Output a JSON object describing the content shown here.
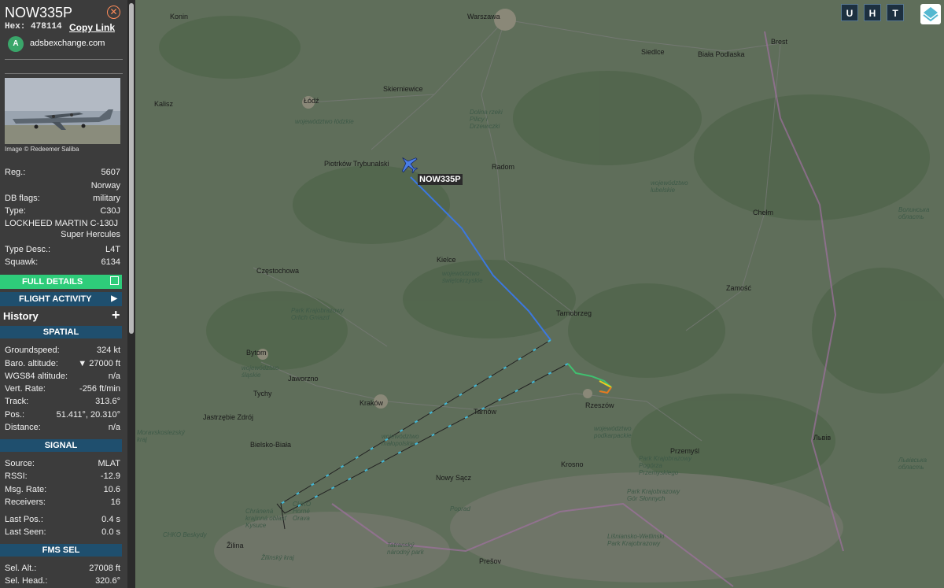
{
  "aircraft": {
    "callsign": "NOW335P",
    "hex_label": "Hex:",
    "hex": "478114",
    "copy_link": "Copy Link",
    "source_site": "adsbexchange.com",
    "photo_credit": "Image © Redeemer Saliba"
  },
  "details": {
    "reg_label": "Reg.:",
    "reg": "5607",
    "country": "Norway",
    "dbflags_label": "DB flags:",
    "dbflags": "military",
    "type_label": "Type:",
    "type": "C30J",
    "type_full_1": "LOCKHEED MARTIN C-130J",
    "type_full_2": "Super Hercules",
    "typedesc_label": "Type Desc.:",
    "typedesc": "L4T",
    "squawk_label": "Squawk:",
    "squawk": "6134"
  },
  "buttons": {
    "full_details": "FULL DETAILS",
    "flight_activity": "FLIGHT ACTIVITY",
    "history": "History"
  },
  "spatial": {
    "title": "SPATIAL",
    "rows": [
      {
        "label": "Groundspeed:",
        "value": "324 kt"
      },
      {
        "label": "Baro. altitude:",
        "value": "▼ 27000 ft"
      },
      {
        "label": "WGS84 altitude:",
        "value": "n/a"
      },
      {
        "label": "Vert. Rate:",
        "value": "-256 ft/min"
      },
      {
        "label": "Track:",
        "value": "313.6°"
      },
      {
        "label": "Pos.:",
        "value": "51.411°, 20.310°"
      },
      {
        "label": "Distance:",
        "value": "n/a"
      }
    ]
  },
  "signal": {
    "title": "SIGNAL",
    "rows": [
      {
        "label": "Source:",
        "value": "MLAT"
      },
      {
        "label": "RSSI:",
        "value": "-12.9"
      },
      {
        "label": "Msg. Rate:",
        "value": "10.6"
      },
      {
        "label": "Receivers:",
        "value": "16"
      },
      {
        "label": "Last Pos.:",
        "value": "0.4 s"
      },
      {
        "label": "Last Seen:",
        "value": "0.0 s"
      }
    ]
  },
  "fms": {
    "title": "FMS SEL",
    "rows": [
      {
        "label": "Sel. Alt.:",
        "value": "27008 ft"
      },
      {
        "label": "Sel. Head.:",
        "value": "320.6°"
      }
    ]
  },
  "map": {
    "toolbar": [
      "U",
      "H",
      "T"
    ],
    "plane_label": "NOW335P",
    "colors": {
      "track_blue": "#3c78e0",
      "track_cyan": "#40b8d8",
      "track_yellow": "#e8d020",
      "track_orange": "#e87820"
    },
    "cities": [
      "Warszawa",
      "Siedlce",
      "Brest",
      "Biała Podlaska",
      "Konin",
      "Skierniewice",
      "Łódź",
      "Kalisz",
      "Piotrków Trybunalski",
      "Radom",
      "Chełm",
      "Kielce",
      "Częstochowa",
      "Zamość",
      "Tarnobrzeg",
      "Bytom",
      "Jaworzno",
      "Tychy",
      "Kraków",
      "Tarnów",
      "Rzeszów",
      "Jastrzębie Zdrój",
      "Bielsko-Biała",
      "Nowy Sącz",
      "Krosno",
      "Przemyśl",
      "Львів",
      "Žilina",
      "Prešov"
    ],
    "regions": [
      "województwo łódzkie",
      "Dolina rzeki Pilicy i Drzewiczki",
      "województwo lubelskie",
      "województwo świętokrzyskie",
      "Park Krajobrazowy Orlich Gniazd",
      "województwo śląskie",
      "województwo małopolskie",
      "województwo podkarpackie",
      "CHKO Beskydy",
      "Tatranský národný park",
      "Poprad",
      "Park Krajobrazowy Gór Słonnych",
      "Lišniansko-Wetlinski Park Krajobrazowy",
      "Волинська область",
      "Львівська область",
      "Moravskoslezský kraj",
      "Žilinský kraj",
      "CHKO Horné Orava",
      "Chránená krajinná oblasť Kysuce",
      "Park Krajobrazowy Pogórza Przemyskiego"
    ]
  }
}
